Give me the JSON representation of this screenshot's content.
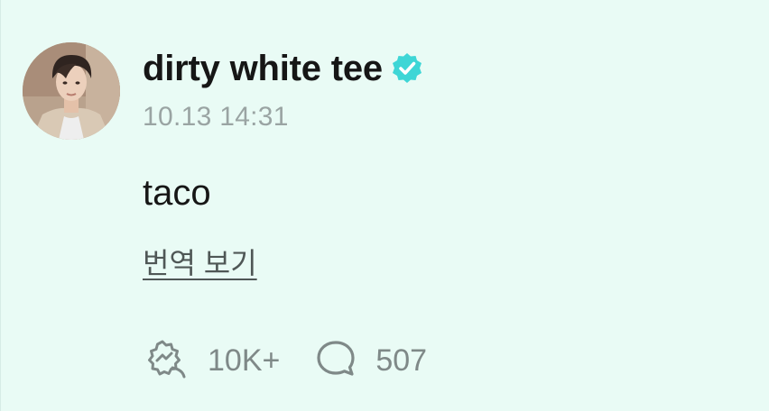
{
  "post": {
    "author": {
      "name": "dirty white tee",
      "verified": true,
      "avatar_icon": "avatar"
    },
    "timestamp": "10.13 14:31",
    "content": "taco",
    "translate_link": "번역 보기",
    "actions": {
      "reaction_icon": "reaction-icon",
      "reaction_count": "10K+",
      "comment_icon": "speech-bubble-icon",
      "comment_count": "507"
    }
  },
  "colors": {
    "background": "#e9fbf5",
    "verified_badge": "#3ed6d6",
    "muted_text": "#9aa4a3",
    "primary_text": "#161616"
  }
}
